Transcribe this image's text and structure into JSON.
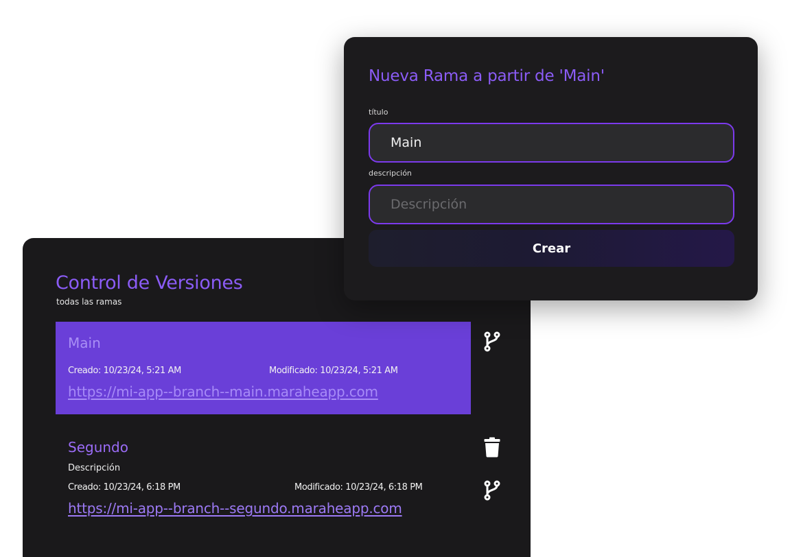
{
  "version_control": {
    "title": "Control de Versiones",
    "subtitle": "todas las ramas",
    "branches": [
      {
        "name": "Main",
        "description": "",
        "created": "Creado: 10/23/24, 5:21 AM",
        "modified": "Modificado: 10/23/24, 5:21 AM",
        "url": "https://mi-app--branch--main.maraheapp.com",
        "active": true,
        "icons": [
          "git-branch-icon"
        ]
      },
      {
        "name": "Segundo",
        "description": "Descripción",
        "created": "Creado: 10/23/24, 6:18 PM",
        "modified": "Modificado: 10/23/24, 6:18 PM",
        "url": "https://mi-app--branch--segundo.maraheapp.com",
        "active": false,
        "icons": [
          "trash-icon",
          "git-branch-icon"
        ]
      }
    ]
  },
  "new_branch_modal": {
    "title": "Nueva Rama a partir de 'Main'",
    "title_label": "título",
    "title_value": "Main",
    "description_label": "descripción",
    "description_value": "",
    "description_placeholder": "Descripción",
    "create_label": "Crear"
  },
  "colors": {
    "accent": "#8b5cf6",
    "active_row": "#6a3fd8",
    "input_border": "#7c3aed",
    "panel_bg": "#1a191b",
    "page_bg": "#ffffff"
  }
}
